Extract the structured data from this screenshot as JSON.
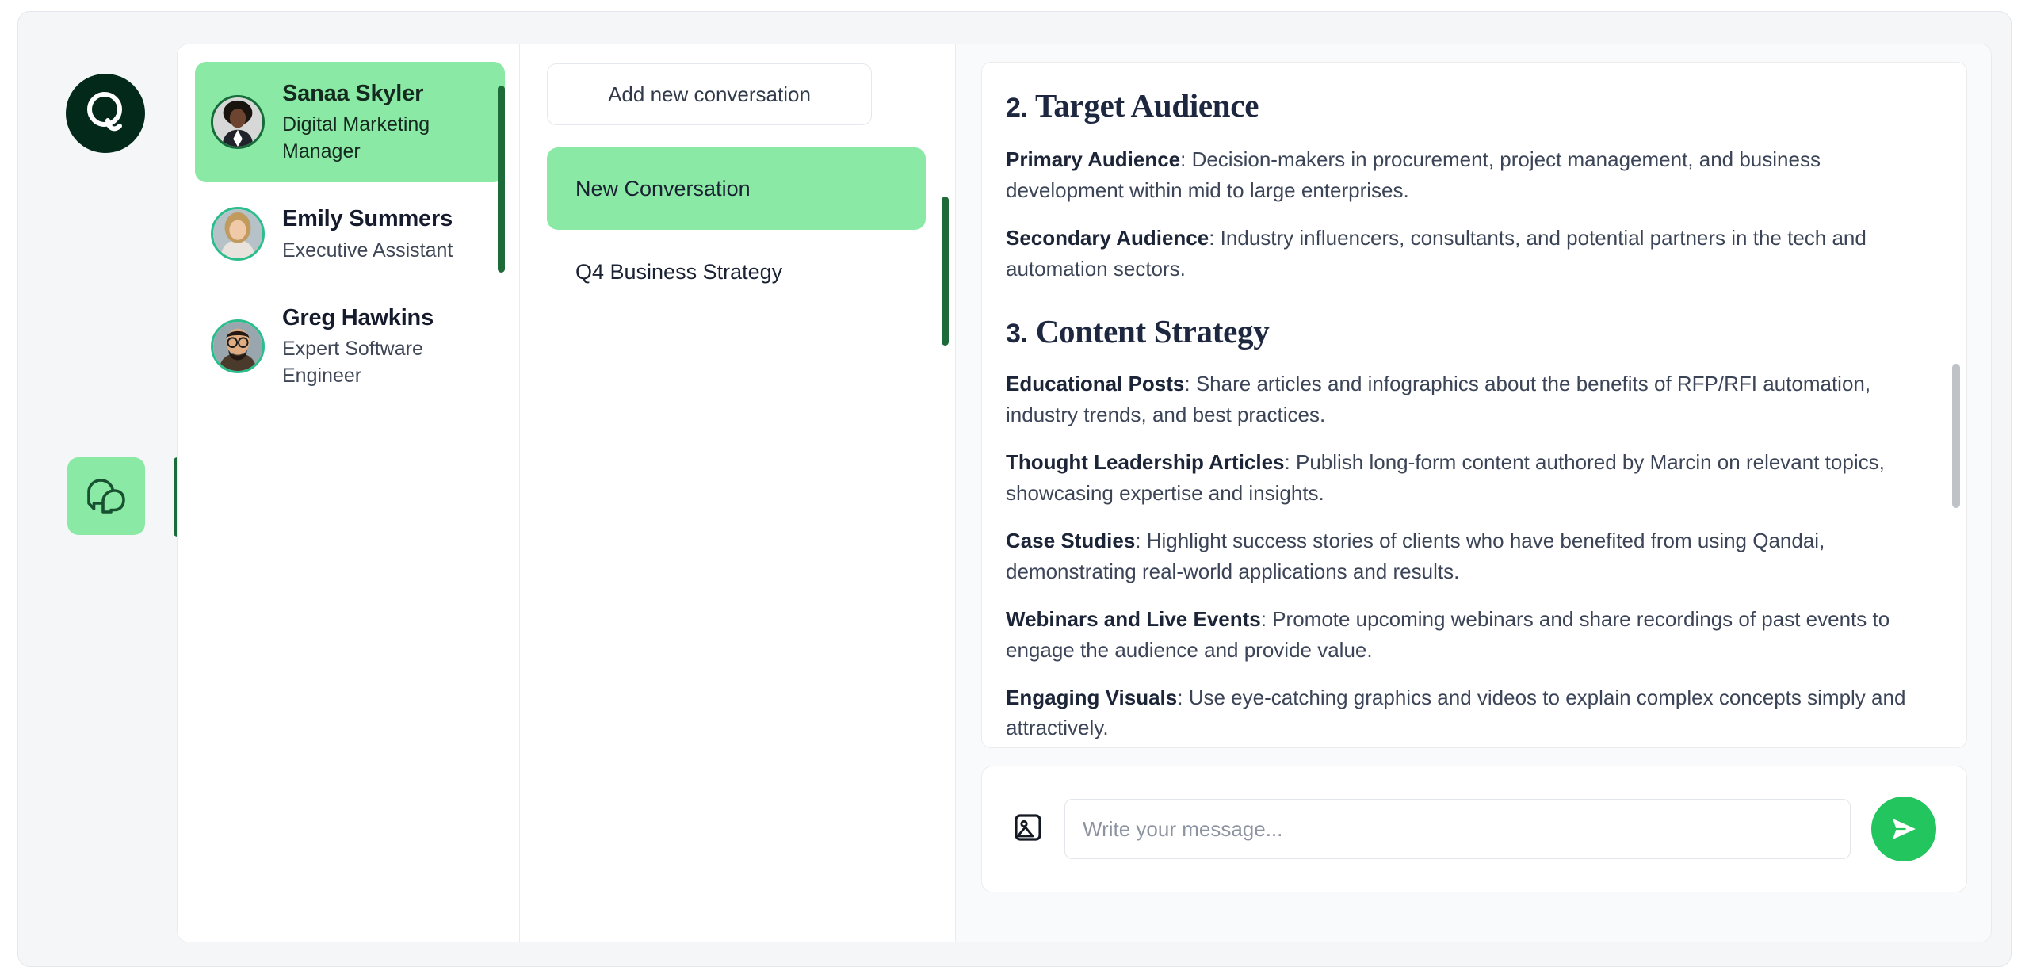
{
  "brand": {
    "logo_letter": "Q",
    "logo_bg": "#03291b",
    "accent_green": "#8ae9a4",
    "accent_dark_green": "#1d6b38",
    "send_green": "#22c55e"
  },
  "rail": {
    "logo_icon": "qandai-logo-icon",
    "chat_icon": "chat-bubbles-icon"
  },
  "contacts": [
    {
      "name": "Sanaa Skyler",
      "role": "Digital Marketing Manager",
      "selected": true,
      "avatar": "avatar-sanaa-skyler"
    },
    {
      "name": "Emily Summers",
      "role": "Executive Assistant",
      "selected": false,
      "avatar": "avatar-emily-summers"
    },
    {
      "name": "Greg Hawkins",
      "role": "Expert Software Engineer",
      "selected": false,
      "avatar": "avatar-greg-hawkins"
    }
  ],
  "conversations": {
    "add_button_label": "Add new conversation",
    "items": [
      {
        "label": "New Conversation",
        "active": true
      },
      {
        "label": "Q4 Business Strategy",
        "active": false
      }
    ]
  },
  "message": {
    "sections": [
      {
        "number": "2.",
        "heading": "Target Audience",
        "paragraphs": [
          {
            "lead": "Primary Audience",
            "text": ": Decision-makers in procurement, project management, and business development within mid to large enterprises."
          },
          {
            "lead": "Secondary Audience",
            "text": ": Industry influencers, consultants, and potential partners in the tech and automation sectors."
          }
        ]
      },
      {
        "number": "3.",
        "heading": "Content Strategy",
        "paragraphs": [
          {
            "lead": "Educational Posts",
            "text": ": Share articles and infographics about the benefits of RFP/RFI automation, industry trends, and best practices."
          },
          {
            "lead": "Thought Leadership Articles",
            "text": ": Publish long-form content authored by Marcin on relevant topics, showcasing expertise and insights."
          },
          {
            "lead": "Case Studies",
            "text": ": Highlight success stories of clients who have benefited from using Qandai, demonstrating real-world applications and results."
          },
          {
            "lead": "Webinars and Live Events",
            "text": ": Promote upcoming webinars and share recordings of past events to engage the audience and provide value."
          },
          {
            "lead": "Engaging Visuals",
            "text": ": Use eye-catching graphics and videos to explain complex concepts simply and attractively."
          }
        ]
      }
    ]
  },
  "composer": {
    "attach_icon": "image-icon",
    "input_value": "",
    "input_placeholder": "Write your message...",
    "send_icon": "send-paper-plane-icon"
  }
}
